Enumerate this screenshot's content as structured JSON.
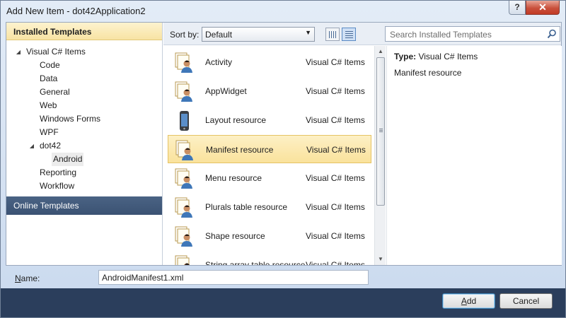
{
  "window": {
    "title": "Add New Item - dot42Application2",
    "help_label": "?",
    "close_label": "✕"
  },
  "left": {
    "installed_header": "Installed Templates",
    "tree": [
      {
        "label": "Visual C# Items",
        "arrow": "◢",
        "level": 0
      },
      {
        "label": "Code",
        "level": 1
      },
      {
        "label": "Data",
        "level": 1
      },
      {
        "label": "General",
        "level": 1
      },
      {
        "label": "Web",
        "level": 1
      },
      {
        "label": "Windows Forms",
        "level": 1
      },
      {
        "label": "WPF",
        "level": 1
      },
      {
        "label": "dot42",
        "arrow": "◢",
        "level": 1
      },
      {
        "label": "Android",
        "level": 2,
        "selected": true
      },
      {
        "label": "Reporting",
        "level": 1
      },
      {
        "label": "Workflow",
        "level": 1
      }
    ],
    "online_header": "Online Templates"
  },
  "toolbar": {
    "sort_label": "Sort by:",
    "sort_value": "Default",
    "search_placeholder": "Search Installed Templates"
  },
  "items": [
    {
      "name": "Activity",
      "category": "Visual C# Items",
      "icon": "person-document-icon"
    },
    {
      "name": "AppWidget",
      "category": "Visual C# Items",
      "icon": "person-document-icon"
    },
    {
      "name": "Layout resource",
      "category": "Visual C# Items",
      "icon": "phone-icon"
    },
    {
      "name": "Manifest resource",
      "category": "Visual C# Items",
      "icon": "person-document-icon",
      "selected": true
    },
    {
      "name": "Menu resource",
      "category": "Visual C# Items",
      "icon": "person-document-icon"
    },
    {
      "name": "Plurals table resource",
      "category": "Visual C# Items",
      "icon": "person-document-icon"
    },
    {
      "name": "Shape resource",
      "category": "Visual C# Items",
      "icon": "person-document-icon"
    },
    {
      "name": "String array table resource",
      "category": "Visual C# Items",
      "icon": "person-document-icon"
    }
  ],
  "details": {
    "type_key": "Type:",
    "type_value": "Visual C# Items",
    "description": "Manifest resource"
  },
  "footer": {
    "name_label_underlined": "N",
    "name_label_rest": "ame:",
    "name_value": "AndroidManifest1.xml",
    "add_underlined": "A",
    "add_rest": "dd",
    "cancel_label": "Cancel"
  },
  "colors": {
    "selection": "#fae29c",
    "online_header": "#3b5273",
    "bottom_bar": "#2b3e5c"
  }
}
